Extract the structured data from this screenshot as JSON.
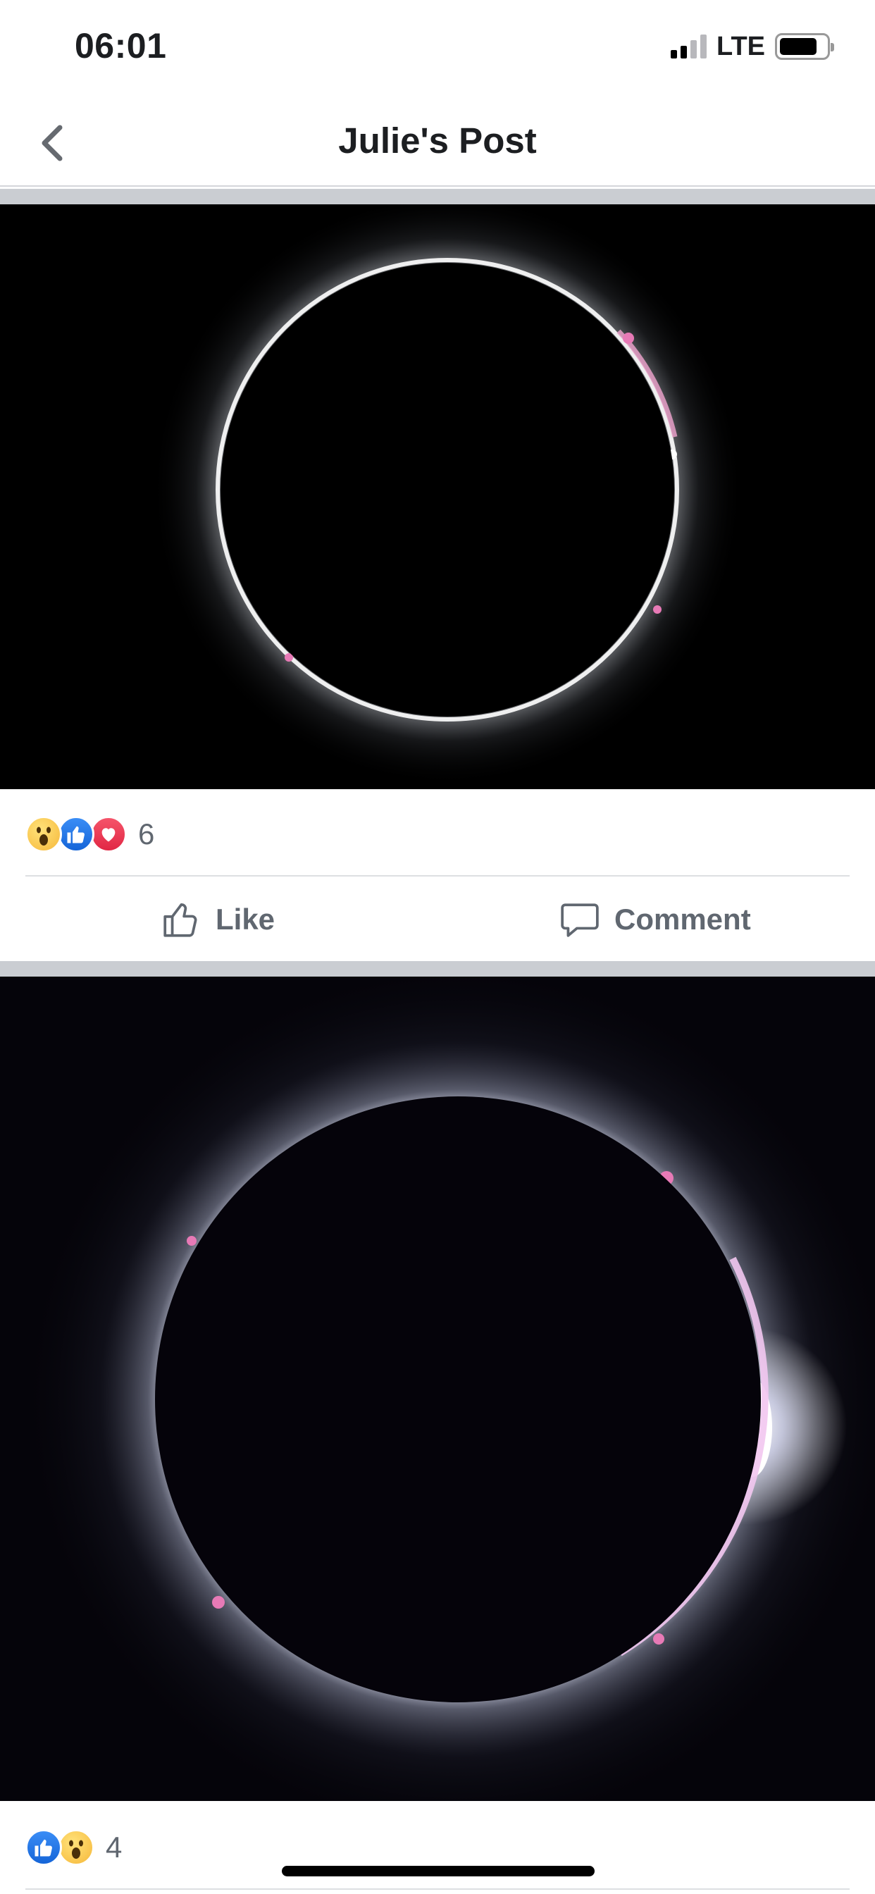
{
  "status_bar": {
    "time": "06:01",
    "network": "LTE",
    "signal_bars": 2,
    "signal_bars_total": 4,
    "battery_level": 0.75
  },
  "nav": {
    "back_icon": "chevron-left-icon",
    "title": "Julie's Post"
  },
  "posts": [
    {
      "photo": "solar-eclipse-photo",
      "reactions": [
        "wow",
        "like",
        "love"
      ],
      "reaction_count": "6",
      "like_label": "Like",
      "comment_label": "Comment"
    },
    {
      "photo": "solar-eclipse-diamond-ring-photo",
      "reactions": [
        "like",
        "wow"
      ],
      "reaction_count": "4"
    }
  ],
  "colors": {
    "like_blue": "#1877f2",
    "love_red": "#e12744",
    "wow_yellow": "#f6b83a",
    "action_gray": "#606770",
    "separator_gray": "#cacdd2"
  }
}
